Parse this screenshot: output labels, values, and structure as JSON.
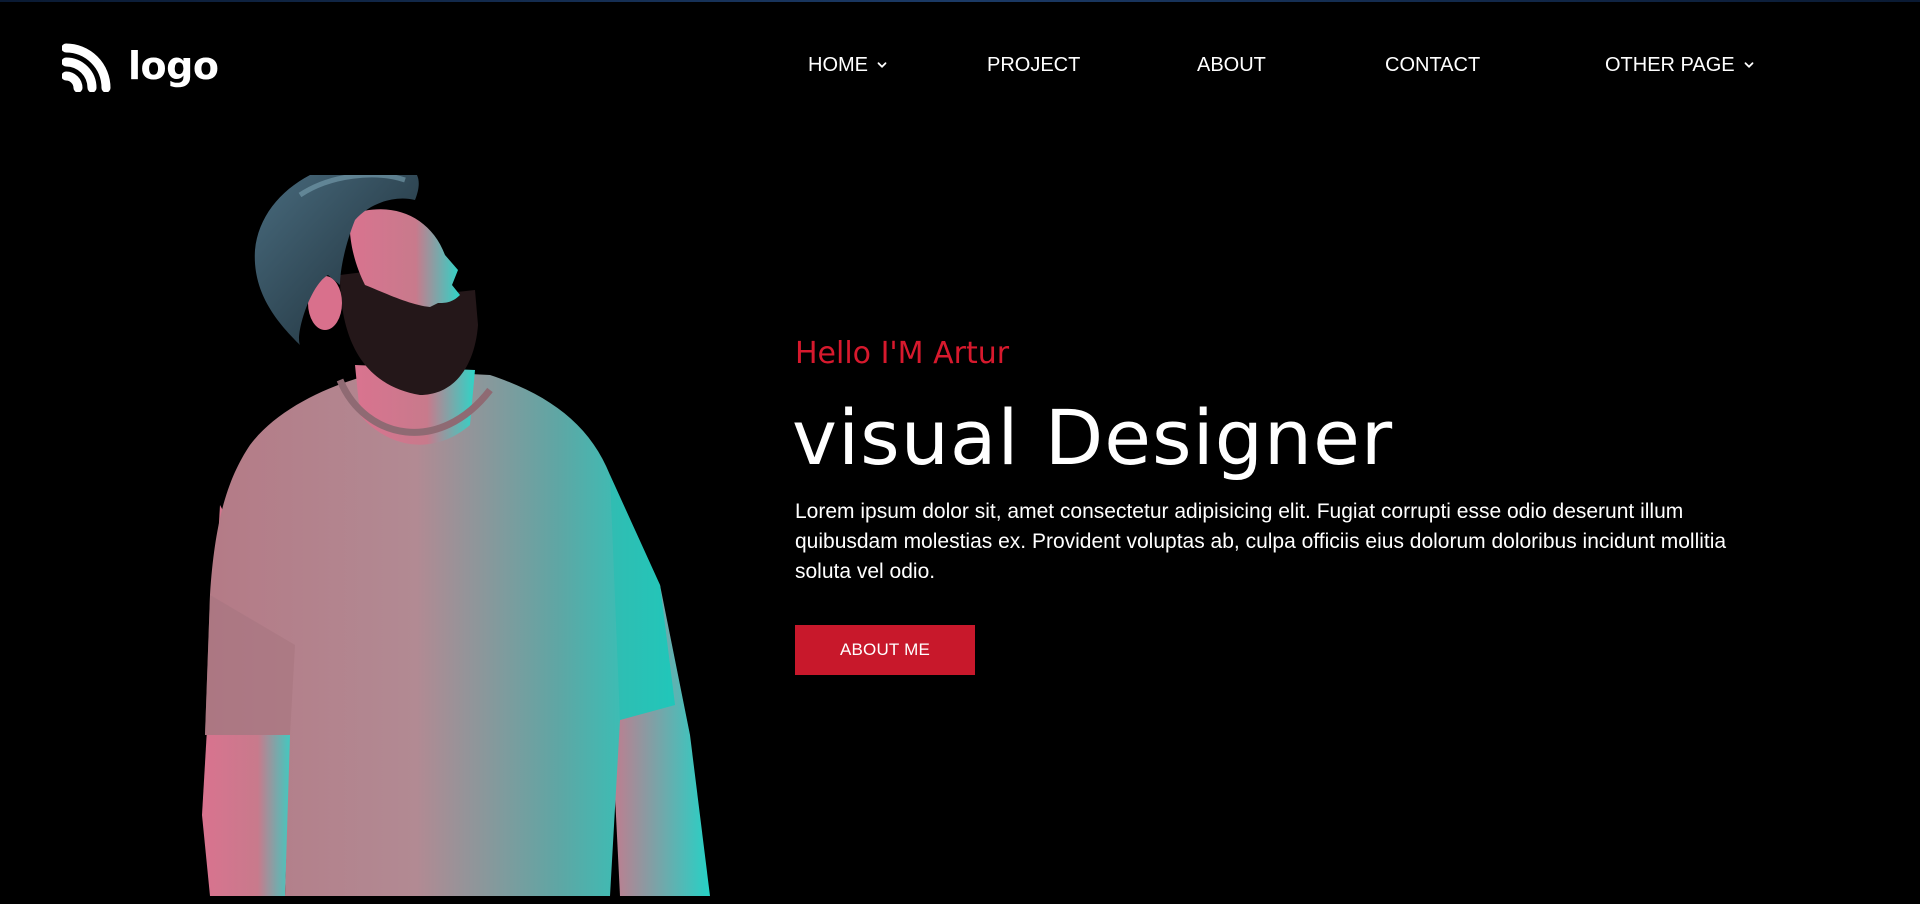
{
  "header": {
    "logo_text": "logo",
    "logo_icon": "wifi-arcs-icon"
  },
  "nav": {
    "items": [
      {
        "label": "HOME",
        "has_dropdown": true
      },
      {
        "label": "PROJECT",
        "has_dropdown": false
      },
      {
        "label": "ABOUT",
        "has_dropdown": false
      },
      {
        "label": "CONTACT",
        "has_dropdown": false
      },
      {
        "label": "OTHER PAGE",
        "has_dropdown": true
      }
    ],
    "dropdown_icon": "chevron-down-icon"
  },
  "hero": {
    "greeting": "Hello I'M Artur",
    "title": "visual Designer",
    "description": "Lorem ipsum dolor sit, amet consectetur adipisicing elit. Fugiat corrupti esse odio deserunt illum quibusdam molestias ex. Provident voluptas ab, culpa officiis eius dolorum doloribus incidunt mollitia soluta vel odio.",
    "cta_label": "ABOUT ME",
    "portrait": "bearded-man-portrait"
  },
  "colors": {
    "background": "#000000",
    "accent": "#c8182b",
    "greeting_text": "#d7192d",
    "text": "#ffffff",
    "portrait_cyan": "#1fd8c7",
    "portrait_pink": "#e0789a"
  }
}
